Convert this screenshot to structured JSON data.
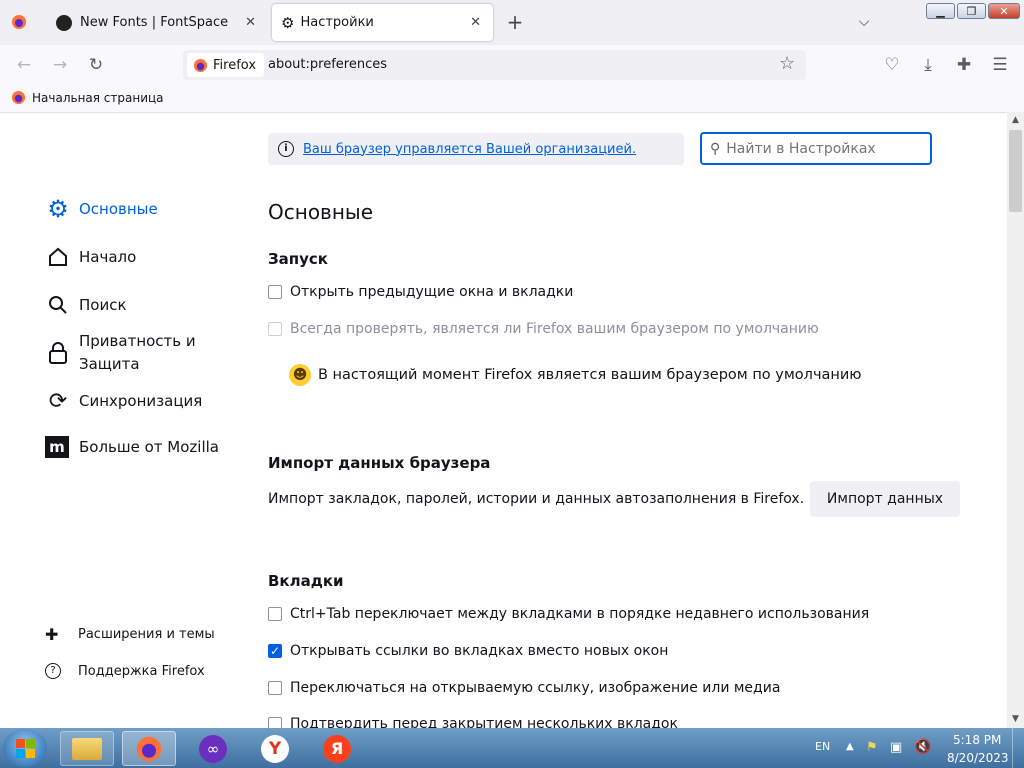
{
  "tabs": [
    {
      "label": "New Fonts | FontSpace"
    },
    {
      "label": "Настройки"
    }
  ],
  "urlbar": {
    "identity": "Firefox",
    "url": "about:preferences"
  },
  "bookmarks": [
    {
      "label": "Начальная страница"
    }
  ],
  "notice": {
    "link": "Ваш браузер управляется Вашей организацией."
  },
  "search": {
    "placeholder": "Найти в Настройках"
  },
  "sidebar": {
    "items": [
      {
        "label": "Основные"
      },
      {
        "label": "Начало"
      },
      {
        "label": "Поиск"
      },
      {
        "label": "Приватность и Защита"
      },
      {
        "label": "Синхронизация"
      },
      {
        "label": "Больше от Mozilla"
      }
    ],
    "footer": [
      {
        "label": "Расширения и темы"
      },
      {
        "label": "Поддержка Firefox"
      }
    ]
  },
  "main": {
    "title": "Основные",
    "startup": {
      "heading": "Запуск",
      "restore": "Открыть предыдущие окна и вкладки",
      "always_check": "Всегда проверять, является ли Firefox вашим браузером по умолчанию",
      "default_status": "В настоящий момент Firefox является вашим браузером по умолчанию"
    },
    "import": {
      "heading": "Импорт данных браузера",
      "description": "Импорт закладок, паролей, истории и данных автозаполнения в Firefox.",
      "button": "Импорт данных"
    },
    "tabs_section": {
      "heading": "Вкладки",
      "options": [
        {
          "label": "Ctrl+Tab переключает между вкладками в порядке недавнего использования",
          "checked": false
        },
        {
          "label": "Открывать ссылки во вкладках вместо новых окон",
          "checked": true
        },
        {
          "label": "Переключаться на открываемую ссылку, изображение или медиа",
          "checked": false
        },
        {
          "label": "Подтвердить перед закрытием нескольких вкладок",
          "checked": false
        }
      ]
    }
  },
  "taskbar": {
    "lang": "EN",
    "time": "5:18 PM",
    "date": "8/20/2023"
  },
  "colors": {
    "accent": "#0061e0",
    "tabbar": "#f0f0f4"
  }
}
